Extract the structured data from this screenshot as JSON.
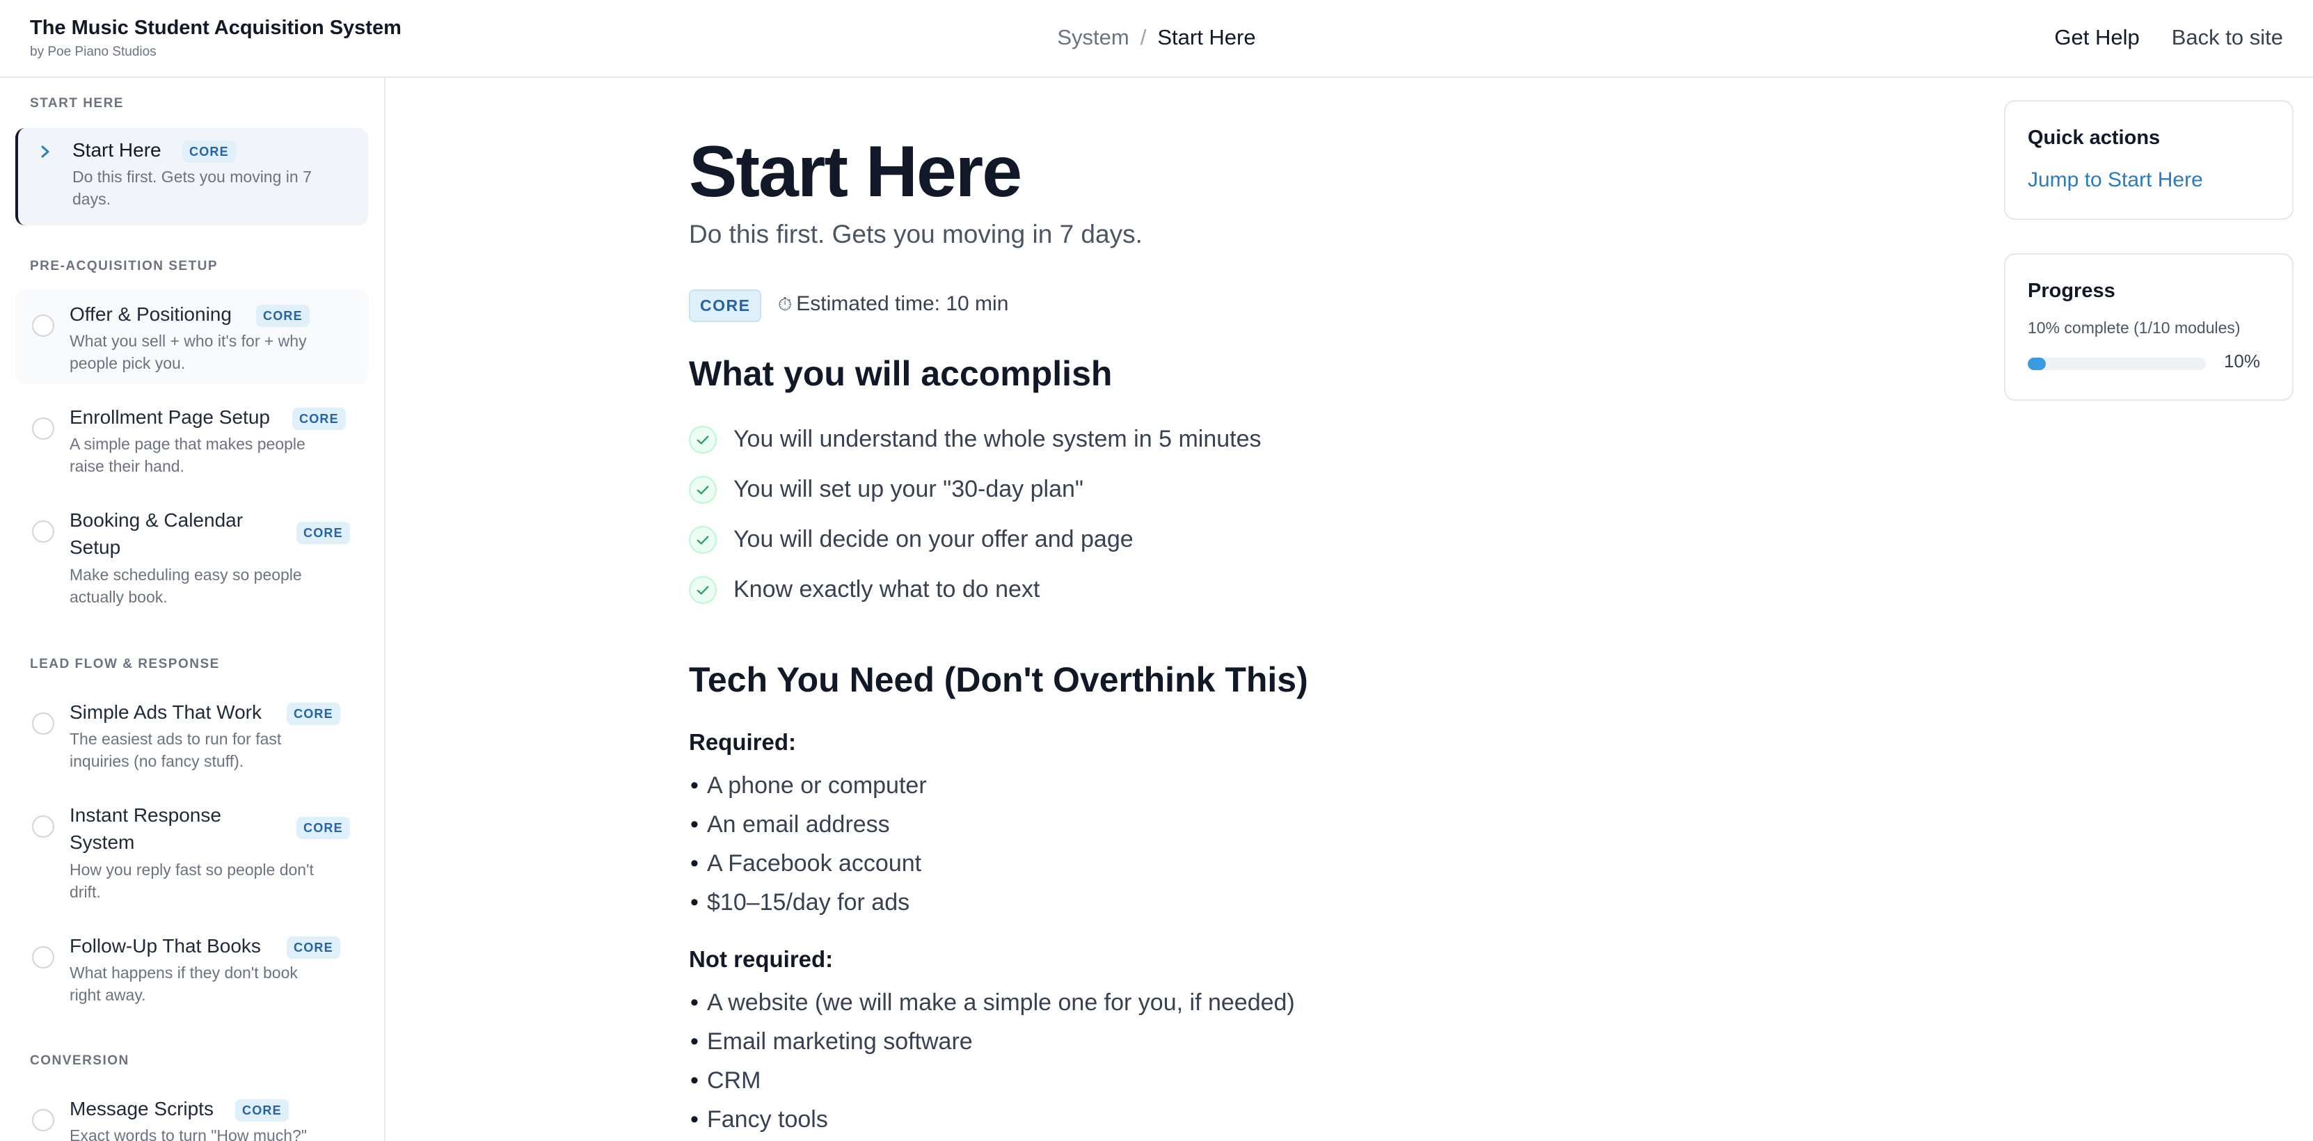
{
  "header": {
    "title": "The Music Student Acquisition System",
    "subtitle": "by Poe Piano Studios",
    "breadcrumb": {
      "parent": "System",
      "separator": "/",
      "current": "Start Here"
    },
    "links": {
      "help": "Get Help",
      "back": "Back to site"
    }
  },
  "sidebar": {
    "sections": [
      {
        "title": "START HERE"
      },
      {
        "title": "PRE-ACQUISITION SETUP"
      },
      {
        "title": "LEAD FLOW & RESPONSE"
      },
      {
        "title": "CONVERSION"
      }
    ],
    "items": [
      {
        "title": "Start Here",
        "badge": "CORE",
        "desc1": "Do this first. Gets you moving in 7",
        "desc2": "days."
      },
      {
        "title": "Offer & Positioning",
        "badge": "CORE",
        "desc1": "What you sell + who it's for + why",
        "desc2": "people pick you."
      },
      {
        "title": "Enrollment Page Setup",
        "badge": "CORE",
        "desc1": "A simple page that makes people",
        "desc2": "raise their hand."
      },
      {
        "title1": "Booking & Calendar",
        "title2": "Setup",
        "badge": "CORE",
        "desc1": "Make scheduling easy so people",
        "desc2": "actually book."
      },
      {
        "title": "Simple Ads That Work",
        "badge": "CORE",
        "desc1": "The easiest ads to run for fast",
        "desc2": "inquiries (no fancy stuff)."
      },
      {
        "title1": "Instant Response",
        "title2": "System",
        "badge": "CORE",
        "desc1": "How you reply fast so people don't",
        "desc2": "drift."
      },
      {
        "title": "Follow-Up That Books",
        "badge": "CORE",
        "desc1": "What happens if they don't book",
        "desc2": "right away."
      },
      {
        "title": "Message Scripts",
        "badge": "CORE",
        "desc1": "Exact words to turn \"How much?\""
      }
    ]
  },
  "main": {
    "title": "Start Here",
    "subtitle": "Do this first. Gets you moving in 7 days.",
    "badge": "CORE",
    "estimate": "Estimated time: 10 min",
    "accomplish_heading": "What you will accomplish",
    "accomplish": [
      "You will understand the whole system in 5 minutes",
      "You will set up your \"30-day plan\"",
      "You will decide on your offer and page",
      "Know exactly what to do next"
    ],
    "tech_heading": "Tech You Need (Don't Overthink This)",
    "required_label": "Required:",
    "required": [
      "A phone or computer",
      "An email address",
      "A Facebook account",
      "$10–15/day for ads"
    ],
    "not_required_label": "Not required:",
    "not_required": [
      "A website (we will make a simple one for you, if needed)",
      "Email marketing software",
      "CRM",
      "Fancy tools"
    ]
  },
  "quick_actions": {
    "title": "Quick actions",
    "link": "Jump to Start Here"
  },
  "progress": {
    "title": "Progress",
    "text": "10% complete (1/10 modules)",
    "percent_label": "10%",
    "fraction": 0.1
  },
  "colors": {
    "accent": "#3b9be0",
    "link": "#2b7bbf",
    "badge_text": "#2563a6",
    "badge_bg": "#e0f0fa",
    "check": "#22a55b"
  },
  "icons": {
    "active_item": "chevron-right-icon",
    "module_status": "radio-empty-icon",
    "estimate": "stopwatch-icon",
    "accomplish": "check-circle-icon"
  }
}
